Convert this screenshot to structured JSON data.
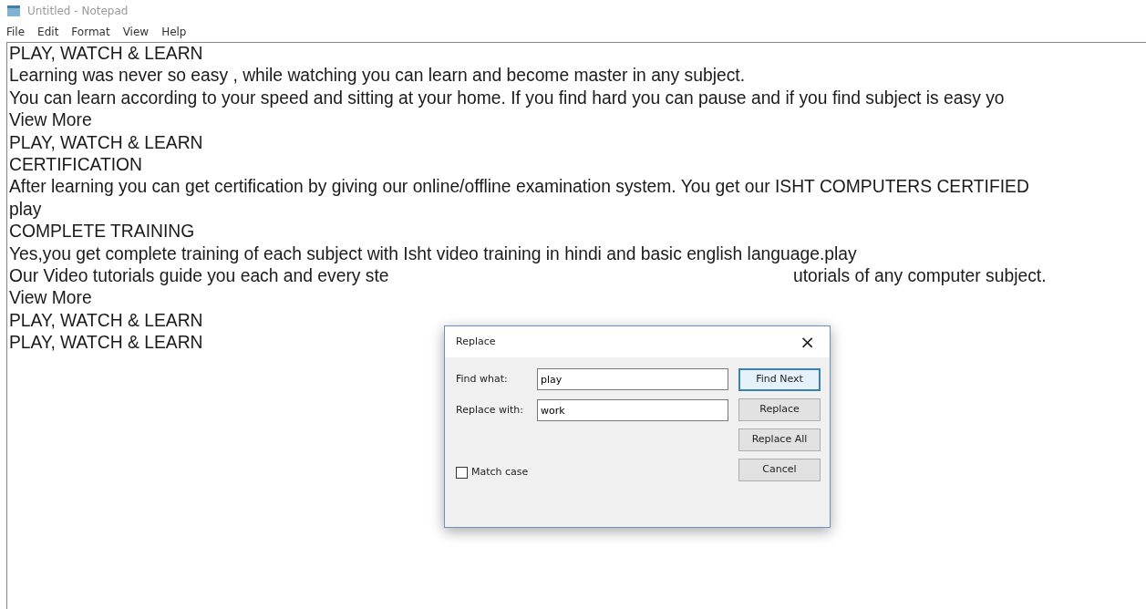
{
  "window": {
    "title": "Untitled - Notepad"
  },
  "menu": [
    "File",
    "Edit",
    "Format",
    "View",
    "Help"
  ],
  "lines": [
    {
      "text": "PLAY, WATCH & LEARN"
    },
    {
      "text": "Learning was never so easy , while watching you can learn and become master in any subject."
    },
    {
      "text": "You can learn according to your speed and sitting at your home. If you find hard you can pause and if you find subject is easy yo"
    },
    {
      "text": "View More"
    },
    {
      "text": "PLAY, WATCH & LEARN"
    },
    {
      "text": "CERTIFICATION"
    },
    {
      "text": "After learning you can get certification by giving our online/offline examination system. You get our ISHT COMPUTERS CERTIFIED"
    },
    {
      "text": "play"
    },
    {
      "text": "COMPLETE TRAINING"
    },
    {
      "text": "Yes,you get complete training of each subject with Isht video training in hindi and basic english language.play"
    },
    {
      "text": "Our Video tutorials guide you each and every ste",
      "text_after_dialog": "utorials of any computer subject."
    },
    {
      "text": "View More"
    },
    {
      "text": "PLAY, WATCH & LEARN"
    },
    {
      "text": "PLAY, WATCH & LEARN"
    }
  ],
  "dialog": {
    "title": "Replace",
    "close": "×",
    "fields": [
      {
        "label": "Find what:",
        "value": "play"
      },
      {
        "label": "Replace with:",
        "value": "work"
      }
    ],
    "buttons": [
      {
        "label": "Find Next",
        "focused": true
      },
      {
        "label": "Replace",
        "focused": false
      },
      {
        "label": "Replace All",
        "focused": false
      },
      {
        "label": "Cancel",
        "focused": false
      }
    ],
    "match_case": {
      "label": "Match case",
      "checked": false
    }
  }
}
